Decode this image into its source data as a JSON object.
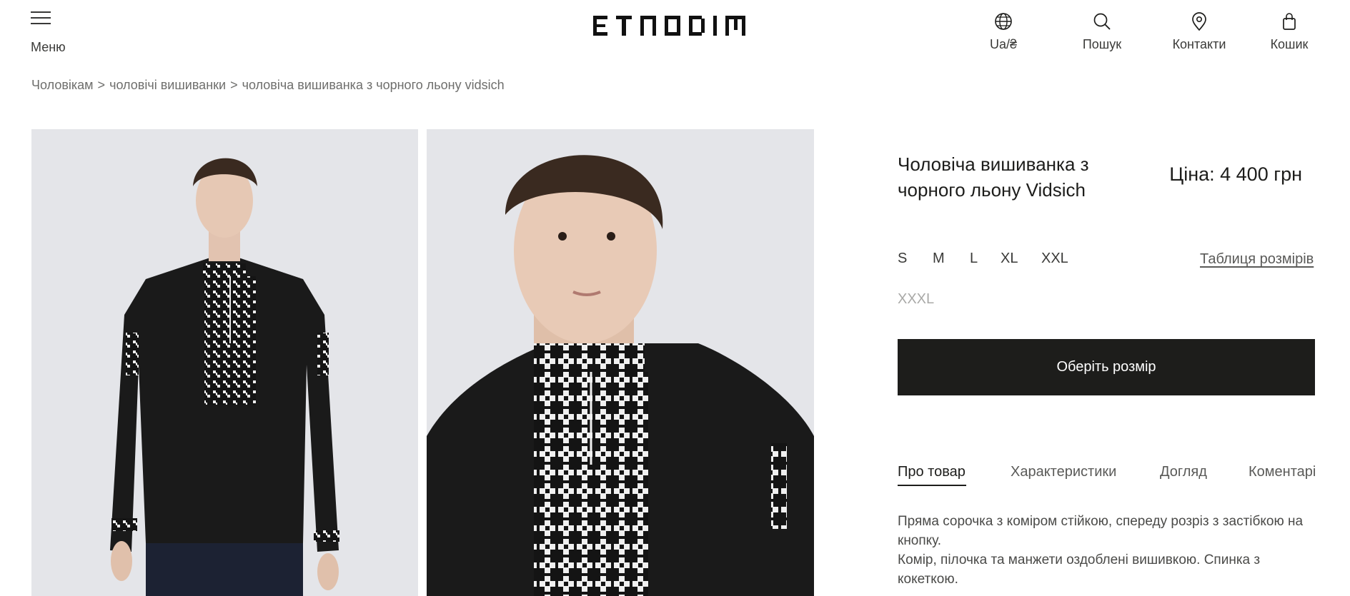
{
  "header": {
    "menu_label": "Меню",
    "logo_text": "ETNODIM",
    "lang_label": "Ua/₴",
    "search_label": "Пошук",
    "contacts_label": "Контакти",
    "cart_label": "Кошик"
  },
  "breadcrumb": {
    "items": [
      "Чоловікам",
      "чоловічі вишиванки",
      "чоловіча вишиванка з чорного льону vidsich"
    ],
    "separator": ">"
  },
  "product": {
    "title": "Чоловіча вишиванка з чорного льону Vidsich",
    "price": "Ціна: 4 400 грн",
    "sizes": [
      "S",
      "M",
      "L",
      "XL",
      "XXL"
    ],
    "unavailable_sizes": [
      "XXXL"
    ],
    "size_table_label": "Таблиця розмірів",
    "cta_label": "Оберіть розмір",
    "tabs": [
      "Про товар",
      "Характеристики",
      "Догляд",
      "Коментарі"
    ],
    "active_tab": "Про товар",
    "description": [
      "Пряма сорочка з коміром стійкою, спереду розріз з застібкою на кнопку.",
      "Комір, пілочка та манжети оздоблені вишивкою. Спинка з кокеткою."
    ]
  },
  "colors": {
    "text": "#1d1d1b",
    "muted": "#6e6e6c",
    "button_bg": "#1d1d1b",
    "button_text": "#ffffff",
    "photo_bg": "#e4e5e9",
    "shirt": "#1a1a1a",
    "embroidery": "#f2f2f2"
  }
}
